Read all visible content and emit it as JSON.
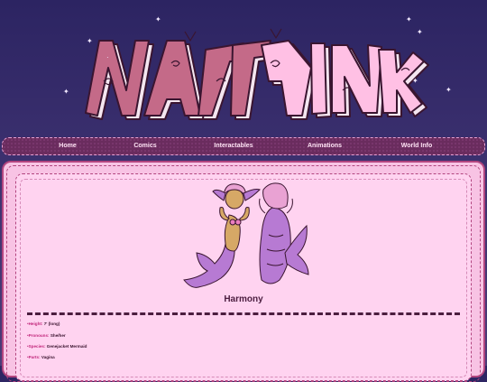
{
  "banner": {
    "logo_text": "NASTY PINK",
    "logo_colors": {
      "dark": "#c46a88",
      "light": "#ffc0e4",
      "outline": "#3a1530",
      "shadow": "#f4e6f0"
    }
  },
  "nav": {
    "items": [
      {
        "label": "Home"
      },
      {
        "label": "Comics"
      },
      {
        "label": "Interactables"
      },
      {
        "label": "Animations"
      },
      {
        "label": "World Info"
      }
    ]
  },
  "character": {
    "name": "Harmony",
    "image": "character-reference-front-back"
  },
  "info": [
    {
      "label": "•Height:",
      "value": "7' (long)"
    },
    {
      "label": "•Pronouns:",
      "value": "She/her"
    },
    {
      "label": "•Species:",
      "value": "Genejacket Mermaid"
    },
    {
      "label": "•Parts:",
      "value": "Vagina"
    }
  ],
  "colors": {
    "page_bg_top": "#2c2462",
    "nav_bg": "#6a2c5e",
    "panel_bg": "#ffd3f0",
    "accent": "#c2287c",
    "text_dark": "#4b1d3f"
  }
}
